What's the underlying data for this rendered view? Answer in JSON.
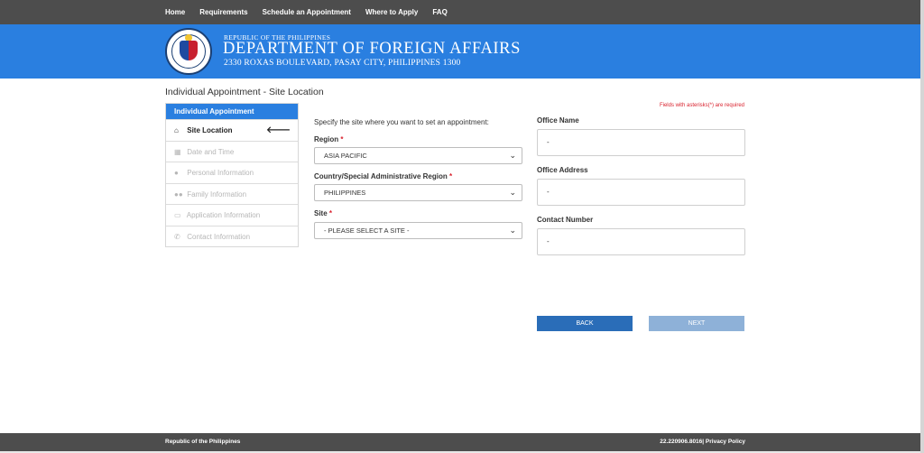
{
  "nav": {
    "items": [
      "Home",
      "Requirements",
      "Schedule an Appointment",
      "Where to Apply",
      "FAQ"
    ]
  },
  "banner": {
    "republic": "REPUBLIC OF THE PHILIPPINES",
    "department": "DEPARTMENT OF FOREIGN AFFAIRS",
    "address": "2330 ROXAS BOULEVARD, PASAY CITY, PHILIPPINES 1300"
  },
  "page": {
    "title": "Individual Appointment - Site Location"
  },
  "steps": {
    "header": "Individual Appointment",
    "items": [
      {
        "label": "Site Location",
        "icon": "home-icon",
        "glyph": "⌂",
        "active": true
      },
      {
        "label": "Date and Time",
        "icon": "calendar-icon",
        "glyph": "▦",
        "active": false
      },
      {
        "label": "Personal Information",
        "icon": "person-icon",
        "glyph": "●",
        "active": false
      },
      {
        "label": "Family Information",
        "icon": "group-icon",
        "glyph": "●●",
        "active": false
      },
      {
        "label": "Application Information",
        "icon": "card-icon",
        "glyph": "▭",
        "active": false
      },
      {
        "label": "Contact Information",
        "icon": "phone-icon",
        "glyph": "✆",
        "active": false
      }
    ],
    "arrow_glyph": "🡐"
  },
  "form": {
    "required_note": "Fields with asterisks(*) are required",
    "instruction": "Specify the site where you want to set an appointment:",
    "region_label": "Region",
    "region_value": "ASIA PACIFIC",
    "country_label": "Country/Special Administrative Region",
    "country_value": "PHILIPPINES",
    "site_label": "Site",
    "site_value": "- PLEASE SELECT A SITE -",
    "asterisk": "*",
    "chevron": "⌄"
  },
  "office": {
    "name_label": "Office Name",
    "name_value": "-",
    "address_label": "Office Address",
    "address_value": "-",
    "contact_label": "Contact Number",
    "contact_value": "-"
  },
  "buttons": {
    "back": "BACK",
    "next": "NEXT"
  },
  "footer": {
    "left": "Republic of the Philippines",
    "right": "22.220906.8016| Privacy Policy"
  },
  "colors": {
    "brand_blue": "#2a7fe0",
    "nav_gray": "#4d4d4d",
    "required_red": "#d9232f"
  }
}
